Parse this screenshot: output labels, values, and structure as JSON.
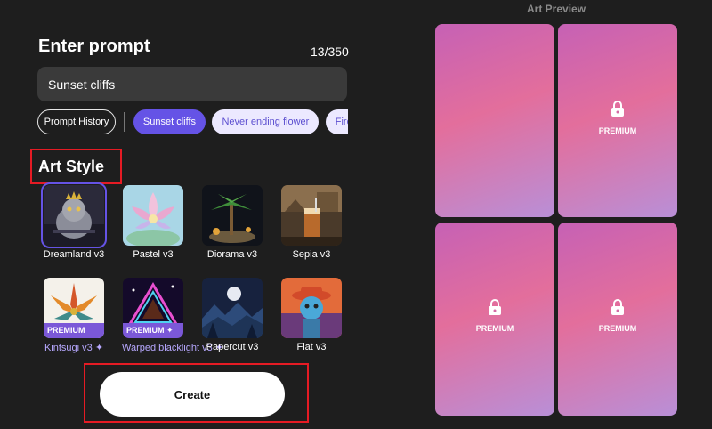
{
  "prompt": {
    "title": "Enter prompt",
    "counter": "13/350",
    "value": "Sunset cliffs"
  },
  "chips": [
    "Prompt History",
    "Sunset cliffs",
    "Never ending flower",
    "Fire and w"
  ],
  "art_style": {
    "title": "Art Style",
    "items": [
      {
        "label": "Dreamland v3",
        "premium": false
      },
      {
        "label": "Pastel v3",
        "premium": false
      },
      {
        "label": "Diorama v3",
        "premium": false
      },
      {
        "label": "Sepia v3",
        "premium": false
      },
      {
        "label": "Kintsugi v3 ✦",
        "premium": true
      },
      {
        "label": "Warped blacklight v3 ✦",
        "premium": true
      },
      {
        "label": "Papercut v3",
        "premium": false
      },
      {
        "label": "Flat v3",
        "premium": false
      }
    ],
    "premium_badge": "PREMIUM",
    "premium_badge_2": "PREMIUM ✦"
  },
  "create_label": "Create",
  "preview": {
    "title": "Art Preview",
    "premium_label": "PREMIUM"
  },
  "colors": {
    "accent": "#6553e6",
    "background": "#1e1e1e",
    "highlight_box": "#e51b24"
  }
}
